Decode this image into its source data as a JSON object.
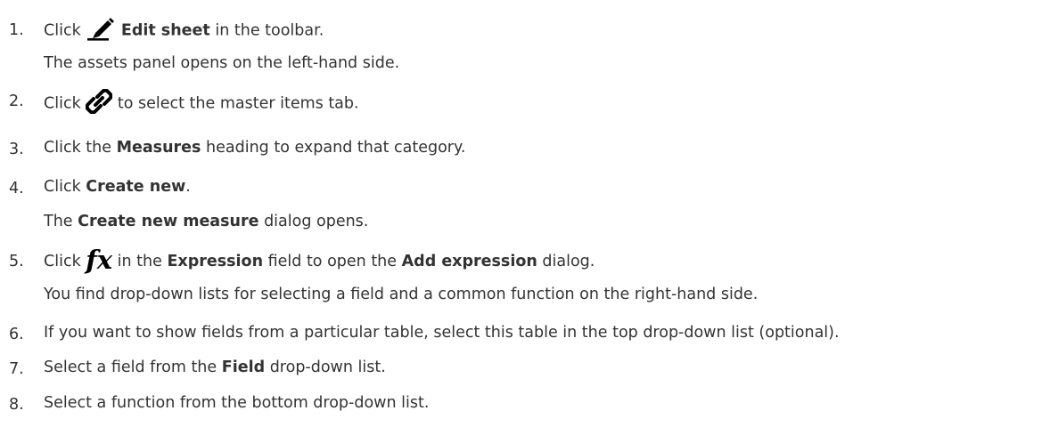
{
  "steps": [
    {
      "number": "1.",
      "pre": "Click",
      "icon": "pencil-icon",
      "bold": "Edit sheet",
      "post": "in the toolbar.",
      "note": "The assets panel opens on the left-hand side."
    },
    {
      "number": "2.",
      "pre": "Click",
      "icon": "link-icon",
      "post": "to select the master items tab."
    },
    {
      "number": "3.",
      "pre": "Click the",
      "bold": "Measures",
      "post": "heading to expand that category."
    },
    {
      "number": "4.",
      "pre": "Click",
      "bold": "Create new",
      "post": ".",
      "note_pre": "The",
      "note_bold": "Create new measure",
      "note_post": "dialog opens."
    },
    {
      "number": "5.",
      "pre": "Click",
      "icon": "fx-icon",
      "icon_text": "fx",
      "mid": "in the",
      "bold": "Expression",
      "mid2": "field to open the",
      "bold2": "Add expression",
      "post": "dialog.",
      "note": "You find drop-down lists for selecting a field and a common function on the right-hand side."
    },
    {
      "number": "6.",
      "text": "If you want to show fields from a particular table, select this table in the top drop-down list (optional)."
    },
    {
      "number": "7.",
      "pre": "Select a field from the",
      "bold": "Field",
      "post": "drop-down list."
    },
    {
      "number": "8.",
      "text": "Select a function from the bottom drop-down list."
    }
  ]
}
